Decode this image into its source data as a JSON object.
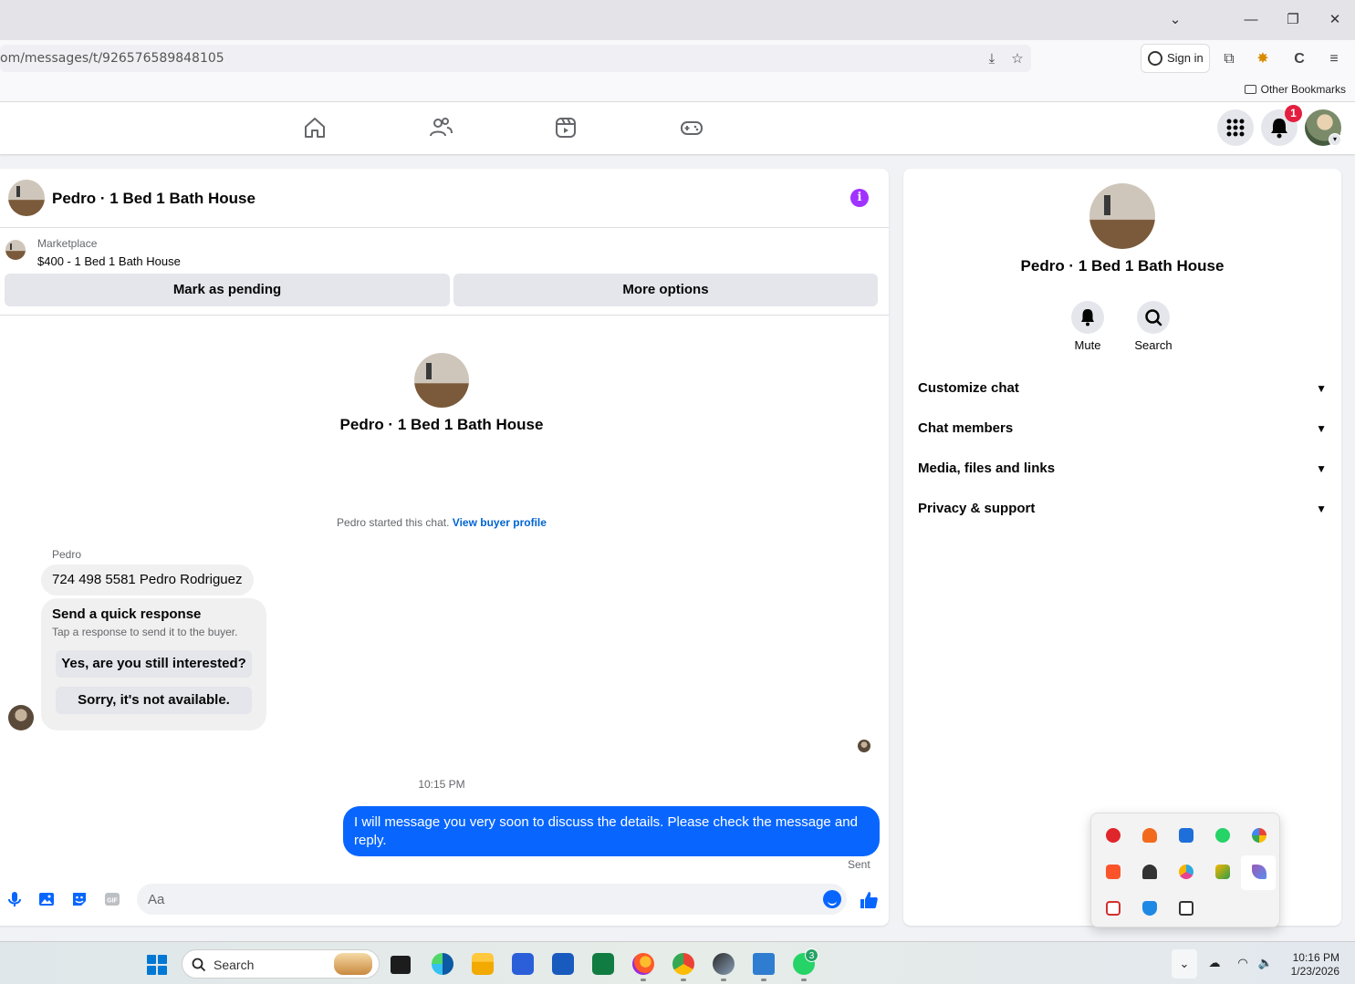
{
  "browser": {
    "url": "om/messages/t/926576589848105",
    "sign_in": "Sign in",
    "other_bookmarks": "Other Bookmarks",
    "window_controls": [
      "chevron-down",
      "minimize",
      "restore",
      "close"
    ]
  },
  "fb_nav": {
    "notification_count": "1",
    "icons": [
      "home-icon",
      "friends-icon",
      "video-icon",
      "gaming-icon",
      "menu-grid-icon",
      "bell-icon"
    ]
  },
  "chat": {
    "title": "Pedro · 1 Bed 1 Bath House",
    "marketplace_label": "Marketplace",
    "listing": "$400 - 1 Bed 1 Bath House",
    "mark_pending": "Mark as pending",
    "more_options": "More options",
    "center_name": "Pedro · 1 Bed 1 Bath House",
    "started_text": "Pedro started this chat.",
    "view_buyer_profile": "View buyer profile",
    "sender_name": "Pedro",
    "incoming_message": "724 498 5581 Pedro Rodriguez",
    "quick_title": "Send a quick response",
    "quick_subtitle": "Tap a response to send it to the buyer.",
    "quick_responses": [
      "Yes, are you still interested?",
      "Sorry, it's not available."
    ],
    "timestamp": "10:15 PM",
    "outgoing_message": "I will message you very soon to discuss the details. Please check the message and reply.",
    "sent_label": "Sent",
    "composer_placeholder": "Aa"
  },
  "right_panel": {
    "name": "Pedro · 1 Bed 1 Bath House",
    "actions": [
      {
        "label": "Mute",
        "icon": "bell-icon"
      },
      {
        "label": "Search",
        "icon": "search-icon"
      }
    ],
    "sections": [
      "Customize chat",
      "Chat members",
      "Media, files and links",
      "Privacy & support"
    ]
  },
  "taskbar": {
    "search_placeholder": "Search",
    "time": "10:16 PM",
    "date": "1/23/2026",
    "whatsapp_badge": "3"
  },
  "colors": {
    "accent": "#0866ff",
    "info": "#a033ff",
    "badge": "#e41e3f"
  }
}
